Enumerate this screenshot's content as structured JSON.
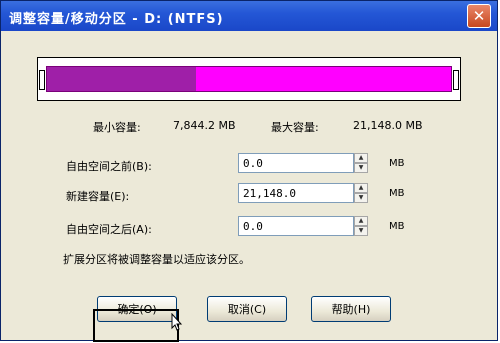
{
  "window": {
    "title": "调整容量/移动分区 - D:  (NTFS)",
    "close_glyph": "✕"
  },
  "partition_bar": {
    "used_fraction": 0.37,
    "used_color": "#9f1fa8",
    "free_color": "#ff00ff"
  },
  "sizes": {
    "min_label": "最小容量:",
    "min_value": "7,844.2 MB",
    "max_label": "最大容量:",
    "max_value": "21,148.0 MB"
  },
  "fields": [
    {
      "label": "自由空间之前(B):",
      "value": "0.0",
      "unit": "MB"
    },
    {
      "label": "新建容量(E):",
      "value": "21,148.0",
      "unit": "MB"
    },
    {
      "label": "自由空间之后(A):",
      "value": "0.0",
      "unit": "MB"
    }
  ],
  "note": "扩展分区将被调整容量以适应该分区。",
  "buttons": {
    "ok": "确定(O)",
    "cancel": "取消(C)",
    "help": "帮助(H)"
  },
  "icons": {
    "spin_up": "▲",
    "spin_down": "▼"
  }
}
